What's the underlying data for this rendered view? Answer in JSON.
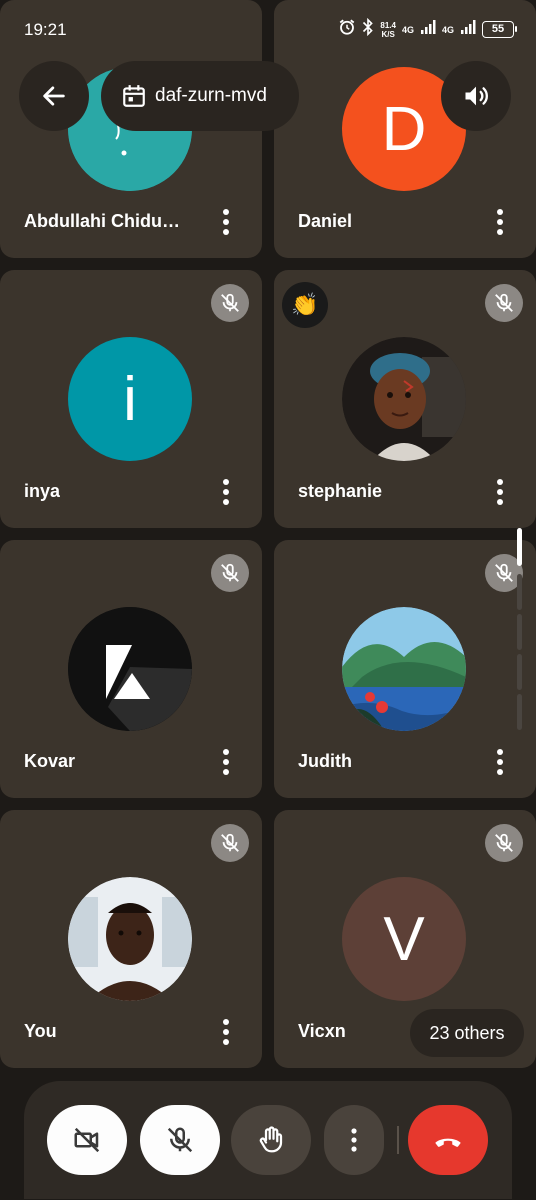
{
  "status_bar": {
    "time": "19:21",
    "net_speed": "81.4",
    "net_unit": "K/S",
    "gen1": "4G",
    "gen2": "4G",
    "battery": "55"
  },
  "header": {
    "meeting_code": "daf-zurn-mvd"
  },
  "participants": [
    {
      "name": "Abdullahi Chidum...",
      "avatar": "image",
      "avatar_color": "#2aa8a6",
      "muted": false
    },
    {
      "name": "Daniel",
      "avatar": "letter",
      "letter": "D",
      "avatar_color": "#f4511e",
      "muted": false
    },
    {
      "name": "inya",
      "avatar": "letter",
      "letter": "i",
      "avatar_color": "#0097a7",
      "muted": true
    },
    {
      "name": "stephanie",
      "avatar": "photo",
      "muted": true,
      "hand_raised": true,
      "hand_emoji": "👏"
    },
    {
      "name": "Kovar",
      "avatar": "logo",
      "avatar_color": "#111111",
      "muted": true
    },
    {
      "name": "Judith",
      "avatar": "illustration",
      "muted": true
    },
    {
      "name": "You",
      "avatar": "photo",
      "muted": true
    },
    {
      "name": "Vicxn",
      "avatar": "letter",
      "letter": "V",
      "avatar_color": "#5d4037",
      "muted": true
    }
  ],
  "others_chip": "23 others",
  "controls": {
    "camera": "camera-off-icon",
    "mic": "mic-off-icon",
    "hand": "raise-hand-icon",
    "more": "more-vertical-icon",
    "end": "end-call-icon"
  },
  "colors": {
    "tile_bg": "#3b342c",
    "end_call": "#e6382d",
    "mute_badge": "#8c8884"
  }
}
